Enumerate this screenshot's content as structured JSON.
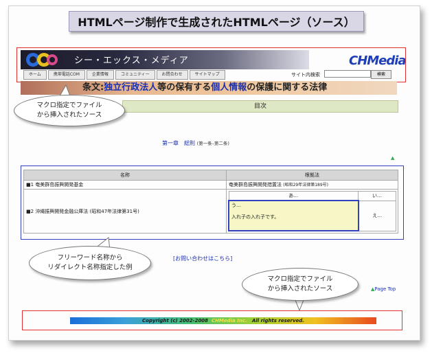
{
  "page_title": "HTMLページ制作で生成されたHTMLページ（ソース）",
  "header": {
    "brand_name": "シー・エックス・メディア",
    "logo_text": "CHMedia",
    "nav_items": [
      "ホーム",
      "携帯電話COM",
      "企業情報",
      "コミュニティー",
      "お問合わせ",
      "サイトマップ"
    ],
    "search_label": "サイト内検索",
    "search_value": "",
    "search_button": "検索"
  },
  "law_title": {
    "prefix": "条文:",
    "part1": "独立行政法人",
    "part2": "等の保有する",
    "part3": "個人情報",
    "part4": "の保護に関する法律"
  },
  "toc_label": "目次",
  "chapter": {
    "link": "第一章　総則",
    "range": "(第一条–第二条)"
  },
  "table": {
    "headers": [
      "名称",
      "根拠法"
    ],
    "rows": [
      {
        "marker": "■1",
        "name": "奄美群島振興開発基金",
        "law": "奄美群島振興開発措置法",
        "law_note": "(昭和29年法律第189号)"
      },
      {
        "marker": "■2",
        "name": "沖縄振興開発金融公庫法 (昭和47年法律第31号)"
      }
    ],
    "nested": {
      "h1": "あ…",
      "h2": "い…",
      "c1_line1": "う…",
      "c1_line2": "入れ子の入れ子です。",
      "c2": "え…"
    }
  },
  "contact_link": "[お問い合わせはこちら]",
  "page_top": "Page Top",
  "footer": {
    "copyright_prefix": "Copyright (c) 2002-2008",
    "copyright_company": "CHMedia Inc.",
    "copyright_suffix": "All rights reserved."
  },
  "callouts": {
    "macro_top": [
      "マクロ指定でファイル",
      "から挿入されたソース"
    ],
    "freeword": [
      "フリーワード名称から",
      "リダイレクト名称指定した例"
    ],
    "macro_bottom": [
      "マクロ指定でファイル",
      "から挿入されたソース"
    ]
  },
  "colors": {
    "outline_red": "#e03030",
    "outline_blue": "#3040c0",
    "link_blue": "#1a2fb0",
    "toc_bg": "#dfe8c4",
    "nested_bg": "#f6f6c6"
  }
}
